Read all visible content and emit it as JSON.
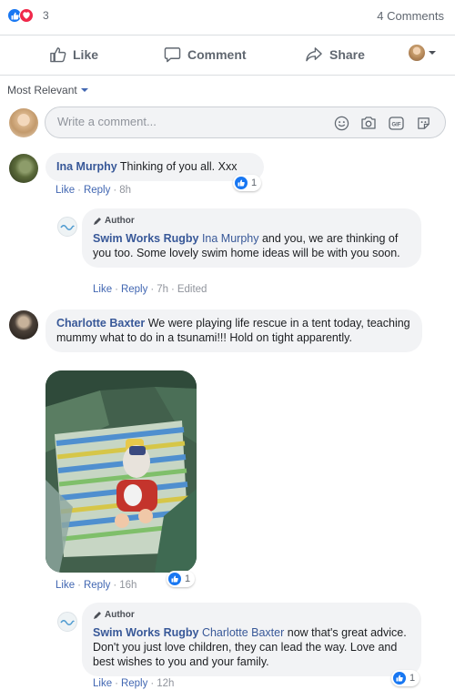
{
  "reactions": {
    "count": "3",
    "comments_label": "4 Comments"
  },
  "actions": {
    "like": "Like",
    "comment": "Comment",
    "share": "Share"
  },
  "sort": {
    "label": "Most Relevant"
  },
  "composer": {
    "placeholder": "Write a comment..."
  },
  "comments": [
    {
      "author": "Ina Murphy",
      "text": "Thinking of you all. Xxx",
      "like": "Like",
      "reply": "Reply",
      "time": "8h",
      "reaction_count": "1",
      "reply_item": {
        "badge": "Author",
        "author": "Swim Works Rugby",
        "tag": "Ina Murphy",
        "text": " and you, we are thinking of you too. Some lovely swim home ideas will be with you soon.",
        "like": "Like",
        "reply": "Reply",
        "time": "7h",
        "edited": "Edited"
      }
    },
    {
      "author": "Charlotte Baxter",
      "text": "We were playing life rescue in a tent today, teaching mummy what to do in a tsunami!!! Hold on tight apparently.",
      "like": "Like",
      "reply": "Reply",
      "time": "16h",
      "reaction_count": "1",
      "reply_item": {
        "badge": "Author",
        "author": "Swim Works Rugby",
        "tag": "Charlotte Baxter",
        "text": " now that's great advice. Don't you just love children, they can lead the way. Love and best wishes to you and your family.",
        "like": "Like",
        "reply": "Reply",
        "time": "12h",
        "reaction_count": "1"
      }
    }
  ],
  "colors": {
    "accent": "#4267b2",
    "link": "#385898",
    "like_blue": "#1877f2",
    "love_red": "#f0284a"
  }
}
